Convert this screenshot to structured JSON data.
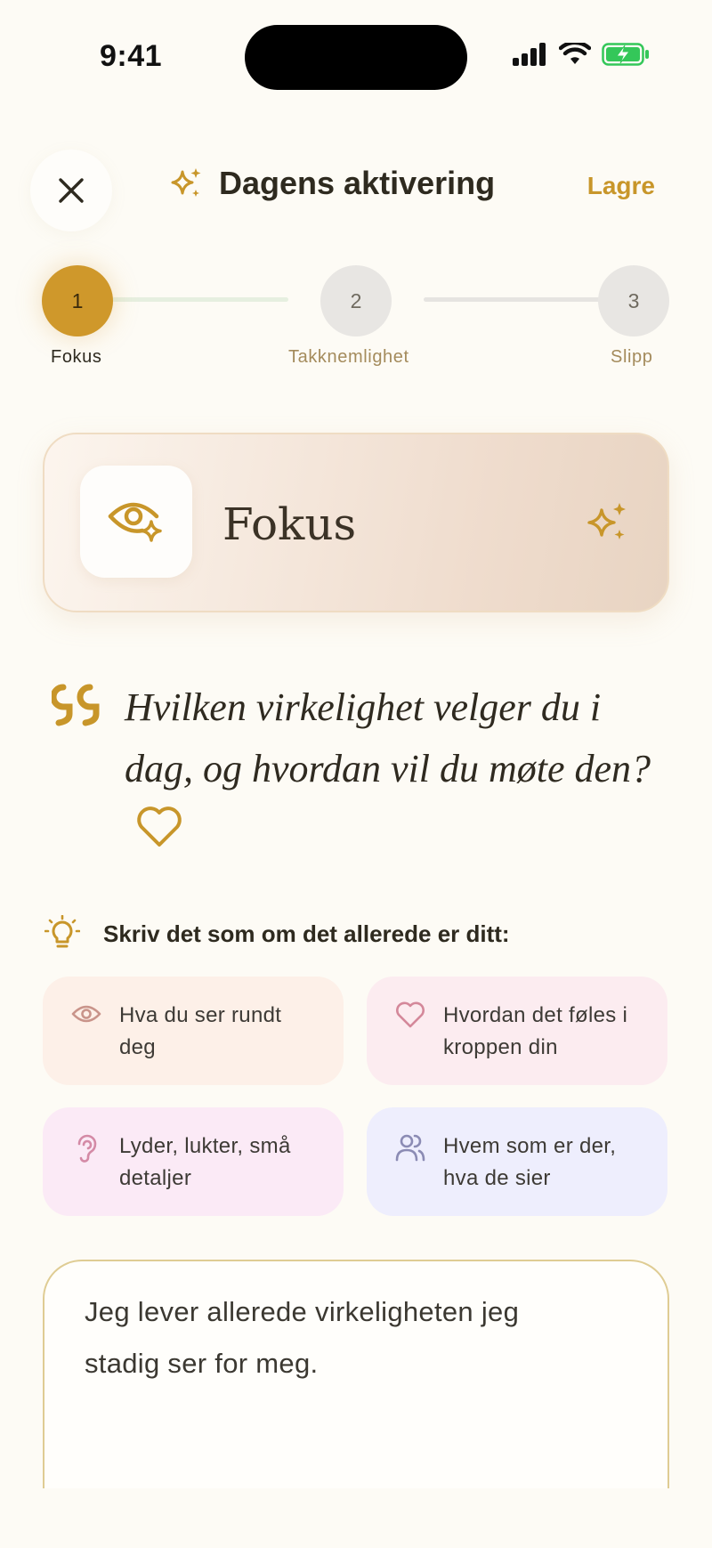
{
  "status_bar": {
    "time": "9:41"
  },
  "header": {
    "title": "Dagens aktivering",
    "save_label": "Lagre"
  },
  "stepper": {
    "steps": [
      {
        "number": "1",
        "label": "Fokus",
        "active": true
      },
      {
        "number": "2",
        "label": "Takknemlighet",
        "active": false
      },
      {
        "number": "3",
        "label": "Slipp",
        "active": false
      }
    ]
  },
  "focus_card": {
    "title": "Fokus"
  },
  "question": {
    "text": "Hvilken virkelighet velger du i dag, og hvordan vil du møte den?"
  },
  "prompt": {
    "title": "Skriv det som om det allerede er ditt:",
    "hints": [
      {
        "icon": "eye-icon",
        "text": "Hva du ser rundt deg"
      },
      {
        "icon": "heart-icon",
        "text": "Hvordan det føles i kroppen din"
      },
      {
        "icon": "ear-icon",
        "text": "Lyder, lukter, små detaljer"
      },
      {
        "icon": "people-icon",
        "text": "Hvem som er der, hva de sier"
      }
    ]
  },
  "answer": {
    "value": "Jeg lever allerede virkeligheten jeg stadig ser for meg."
  },
  "colors": {
    "accent": "#c8962a",
    "background": "#fdfbf5"
  }
}
